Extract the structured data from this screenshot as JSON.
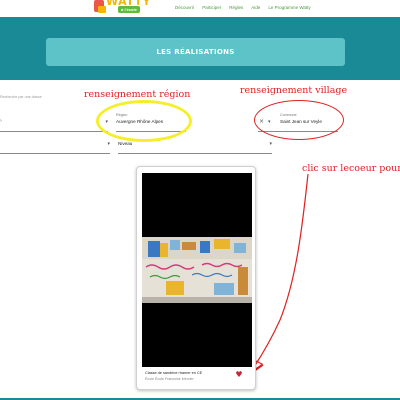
{
  "header": {
    "logo_text": "WATTY",
    "logo_subtext": "à l'école",
    "nav": [
      "Découvrir",
      "Participer",
      "Règles",
      "Aide",
      "Le Programme Watty"
    ]
  },
  "banner": {
    "title": "LES RÉALISATIONS"
  },
  "filters": {
    "hint": "Recherche par une classe",
    "region": {
      "label": "Région",
      "value": "Auvergne Rhône Alpes"
    },
    "commune": {
      "label": "Commune",
      "value": "Saint Jean sur Veyle"
    },
    "niveau": {
      "label": "Niveau",
      "value": ""
    }
  },
  "annotations": {
    "region_note": "renseignement région",
    "village_note": "renseignement village",
    "heart_note": "clic sur lecoeur pour"
  },
  "card": {
    "title": "Classe de sandrine rhamer en CE",
    "subtitle": "École École Francoise Mercier"
  },
  "colors": {
    "banner": "#1a8a96",
    "banner_box": "#5ec2c9",
    "annotation_red": "#e02020",
    "highlight_yellow": "#f5ef2a",
    "heart": "#c0283a"
  }
}
